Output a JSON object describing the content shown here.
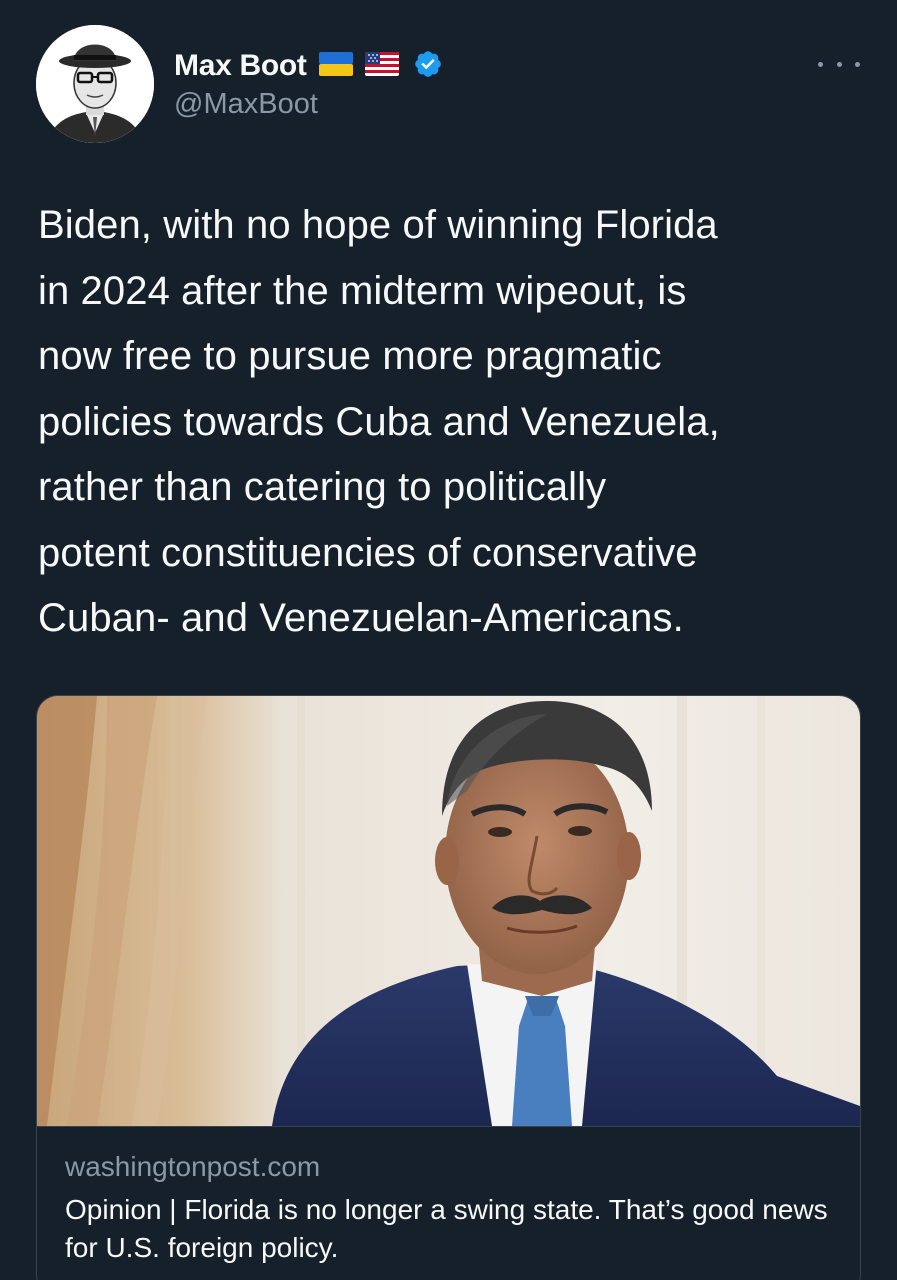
{
  "author": {
    "display_name": "Max Boot",
    "handle": "@MaxBoot",
    "flags": [
      "ukraine-flag",
      "us-flag"
    ],
    "verified": true
  },
  "more_menu": {
    "icon": "more-horizontal-icon"
  },
  "tweet": {
    "text_lines": [
      "Biden, with no hope of winning Florida",
      "in 2024 after the midterm wipeout, is",
      "now free to pursue more pragmatic",
      "policies towards Cuba and Venezuela,",
      "rather than catering to politically",
      "potent constituencies of conservative",
      "Cuban- and Venezuelan-Americans."
    ]
  },
  "link_card": {
    "domain": "washingtonpost.com",
    "title": "Opinion | Florida is no longer a swing state. That’s good news for U.S. foreign policy."
  },
  "colors": {
    "background": "#15202b",
    "text_primary": "#f7f9f9",
    "text_secondary": "#8b98a5",
    "verified_blue": "#1d9bf0",
    "border": "#38444d"
  }
}
